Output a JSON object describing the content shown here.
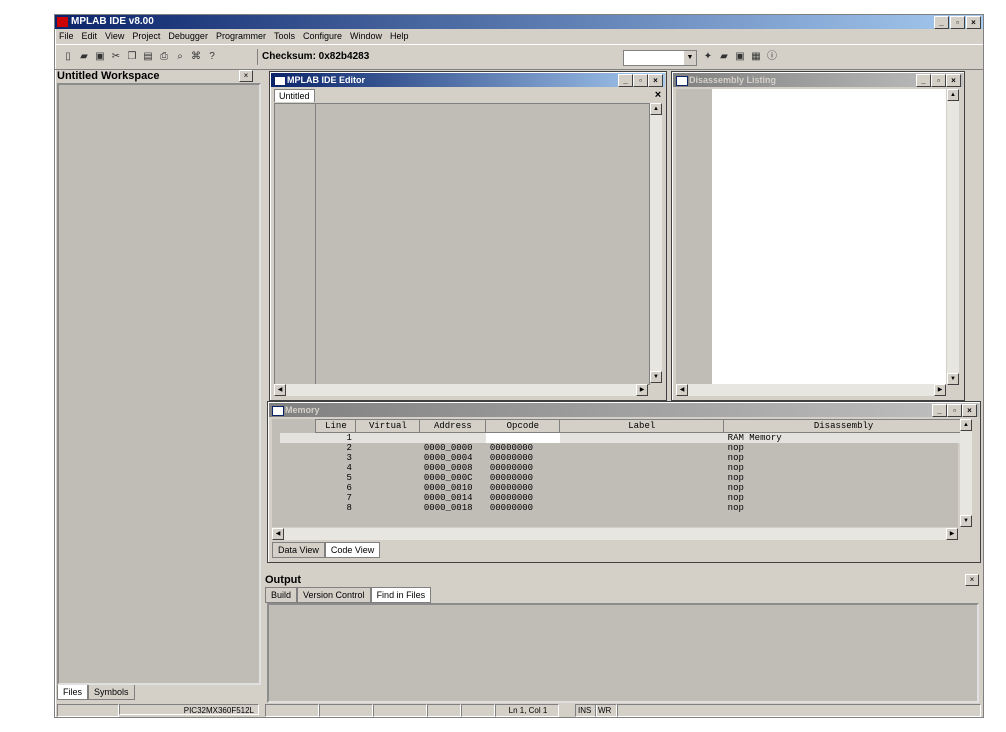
{
  "app": {
    "title": "MPLAB IDE v8.00"
  },
  "menu": [
    "File",
    "Edit",
    "View",
    "Project",
    "Debugger",
    "Programmer",
    "Tools",
    "Configure",
    "Window",
    "Help"
  ],
  "toolbar": {
    "checksum": "Checksum: 0x82b4283"
  },
  "workspace": {
    "title": "Untitled Workspace",
    "tabs": [
      "Files",
      "Symbols"
    ]
  },
  "editor": {
    "title": "MPLAB IDE Editor",
    "tab": "Untitled"
  },
  "disasm": {
    "title": "Disassembly Listing"
  },
  "memory": {
    "title": "Memory",
    "columns": [
      "Line",
      "Virtual",
      "Address",
      "Opcode",
      "Label",
      "Disassembly"
    ],
    "rows": [
      [
        "1",
        "",
        "",
        "",
        "",
        "RAM Memory"
      ],
      [
        "2",
        "",
        "0000_0000",
        "00000000",
        "",
        "nop"
      ],
      [
        "3",
        "",
        "0000_0004",
        "00000000",
        "",
        "nop"
      ],
      [
        "4",
        "",
        "0000_0008",
        "00000000",
        "",
        "nop"
      ],
      [
        "5",
        "",
        "0000_000C",
        "00000000",
        "",
        "nop"
      ],
      [
        "6",
        "",
        "0000_0010",
        "00000000",
        "",
        "nop"
      ],
      [
        "7",
        "",
        "0000_0014",
        "00000000",
        "",
        "nop"
      ],
      [
        "8",
        "",
        "0000_0018",
        "00000000",
        "",
        "nop"
      ]
    ],
    "tabs": [
      "Data View",
      "Code View"
    ]
  },
  "output": {
    "title": "Output",
    "tabs": [
      "Build",
      "Version Control",
      "Find in Files"
    ]
  },
  "status": {
    "device": "PIC32MX360F512L",
    "position": "Ln 1, Col 1",
    "ins": "INS",
    "wr": "WR"
  }
}
